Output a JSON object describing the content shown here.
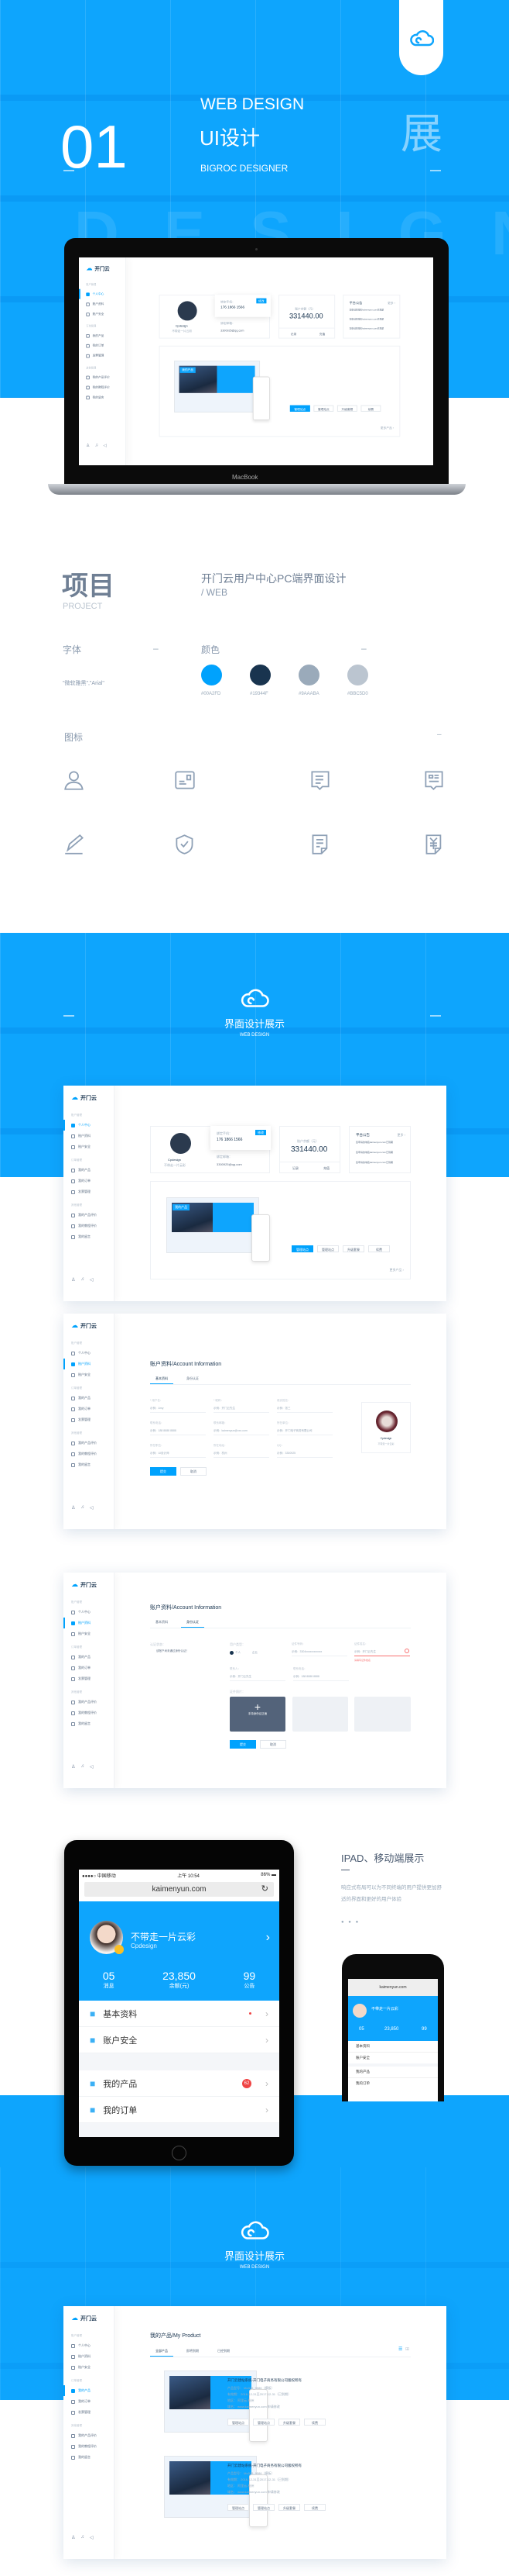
{
  "hero": {
    "number": "01",
    "title_en": "WEB DESIGN",
    "title_cn": "UI设计",
    "designer": "BIGROC DESIGNER",
    "side_char": "展",
    "watermark": "DESIGN",
    "logo_icon": "cloud-icon",
    "laptop_brand": "MacBook"
  },
  "project": {
    "heading": "项目",
    "heading_en": "PROJECT",
    "name": "开门云用户中心PC端界面设计",
    "type": "/ WEB",
    "font_label": "字体",
    "font_value": "\"微软雅黑\",\"Arial\"",
    "color_label": "颜色",
    "colors": [
      {
        "hex": "#00A2FD",
        "label": "#00A2FD"
      },
      {
        "hex": "#19344F",
        "label": "#19344F"
      },
      {
        "hex": "#9AAABA",
        "label": "#9AAABA"
      },
      {
        "hex": "#BBC5D0",
        "label": "#BBC5D0"
      }
    ],
    "icon_label": "图标",
    "dash": "–",
    "icons": [
      "user-icon",
      "id-card-icon",
      "message-icon",
      "news-message-icon",
      "pencil-icon",
      "shield-check-icon",
      "document-icon",
      "invoice-yuan-icon"
    ]
  },
  "section_title": {
    "cn": "界面设计展示",
    "en": "WEB DESIGN"
  },
  "app": {
    "logo": "开门云",
    "sidebar": [
      {
        "group": "账户管理",
        "items": [
          "个人中心",
          "账户资料",
          "账户安全"
        ]
      },
      {
        "group": "订单管理",
        "items": [
          "我的产品",
          "我的订单",
          "发票管理"
        ]
      },
      {
        "group": "其他管理",
        "items": [
          "我的产品评价",
          "我的教程评价",
          "我的留言"
        ]
      }
    ],
    "footer_icons": [
      "user-alert-icon",
      "bell-icon",
      "speaker-icon"
    ]
  },
  "dashboard": {
    "username": "Cpdesign",
    "signature": "不带走一片云彩",
    "phone_label": "绑定手机：",
    "phone": "176 1866 1566",
    "phone_btn": "修改",
    "email_label": "绑定邮箱：",
    "email": "3300925@qq.com",
    "balance_label": "账户余额（元）",
    "balance": "331440.00",
    "record": "记录",
    "recharge": "充值",
    "notice_title": "平台公告",
    "notice_more": "更多 ›",
    "notices": [
      "您申请的域名kaimenyun.com已到期",
      "您申请的域名kaimenyun.com已到期",
      "您申请的域名kaimenyun.com已到期"
    ],
    "product_title": "开门云建站系统-开门电子商务有限公司版权所有",
    "product_lines": [
      "产品型号：  Mo325_9586（模板）",
      "有效期：  2016-12-31至2017-12-31（已到期）",
      "地区：  阿里云-杭州",
      "域名：  www.kaimenyun.com  申请修改"
    ],
    "buttons": [
      "管理站点",
      "管理站点",
      "升级套餐",
      "续费"
    ],
    "more_products": "更多产品 ›",
    "mock_badge": "我的产品"
  },
  "account": {
    "title": "账户资料/Account Information",
    "tabs": [
      "基本资料",
      "身份认证"
    ],
    "fields": [
      {
        "label": "* 用户名：",
        "value": "示例：Amy"
      },
      {
        "label": "* 昵称：",
        "value": "示例：开门云先生"
      },
      {
        "label": "真实姓名：",
        "value": "示例：张三"
      },
      {
        "label": "联系电话：",
        "value": "示例：188 8888 8888"
      },
      {
        "label": "联系邮箱：",
        "value": "示例：kaimenyun@xxx.com"
      },
      {
        "label": "所在单位：",
        "value": "示例：开门电子商务有限公司"
      },
      {
        "label": "所在职位：",
        "value": "示例：UI设计师"
      },
      {
        "label": "所在地址：",
        "value": "示例：杭州"
      },
      {
        "label": "QQ：",
        "value": "示例：3300925"
      }
    ],
    "submit": "提交",
    "cancel": "取消",
    "username": "Cpdesign",
    "signature": "不带走一片云彩"
  },
  "verify": {
    "status_label": "认证状态：",
    "status": "该账户尚未通过身份认证！",
    "type_label": "用户类型：",
    "type_options": [
      "个人",
      "企业"
    ],
    "id_label": "证件号码：",
    "id_value": "示例：3304xxxxxxxxxxxx",
    "name_label": "证件姓名：",
    "name_value": "示例：开门云先生",
    "error": "请填写证件姓名",
    "contact_label": "联系人：",
    "contact_value": "示例：开门云先生",
    "tel_label": "联系电话：",
    "tel_value": "示例：188 8888 8888",
    "upload_label": "证件照片：",
    "upload_text": "手持身份证正面",
    "submit": "提交",
    "cancel": "取消"
  },
  "mobile": {
    "heading": "IPAD、移动端展示",
    "desc": "响应式布局可以为不同终端的用户提供更加舒适的界面和更好的用户体验",
    "carrier": "●●●●○ 中国移动",
    "time": "上午 10:54",
    "battery": "86%",
    "url": "kaimenyun.com",
    "name": "不带走一片云彩",
    "user": "Cpdesign",
    "stats": [
      {
        "value": "05",
        "label": "消息"
      },
      {
        "value": "23,850",
        "label": "余额(元)"
      },
      {
        "value": "99",
        "label": "公告"
      }
    ],
    "menu": [
      {
        "label": "基本资料",
        "icon": "user-icon"
      },
      {
        "label": "账户安全",
        "icon": "shield-icon"
      },
      {
        "label": "我的产品",
        "icon": "monitor-icon",
        "badge": "62"
      },
      {
        "label": "我的订单",
        "icon": "order-icon"
      }
    ]
  },
  "products": {
    "title": "我的产品/My Product",
    "tabs": [
      "全部产品",
      "即将到期",
      "已经到期"
    ],
    "items": [
      {
        "title": "开门云建站系统-开门电子商务有限公司版权所有",
        "lines": [
          "产品型号：  Mo325_9586（模板）",
          "有效期：  2016-12-31至2017-12-31（已到期）",
          "地区：  阿里云-杭州",
          "域名：  www.kaimenyun.com  申请修改"
        ]
      },
      {
        "title": "开门云建站系统-开门电子商务有限公司版权所有",
        "lines": [
          "产品型号：  Mo325_9586（模板）",
          "有效期：  2016-12-31至2017-12-31（已到期）",
          "地区：  阿里云-杭州",
          "域名：  www.kaimenyun.com  申请修改"
        ]
      }
    ],
    "buttons": [
      "管理站点",
      "管理站点",
      "升级套餐",
      "续费"
    ]
  },
  "accent": "#00A2FD"
}
